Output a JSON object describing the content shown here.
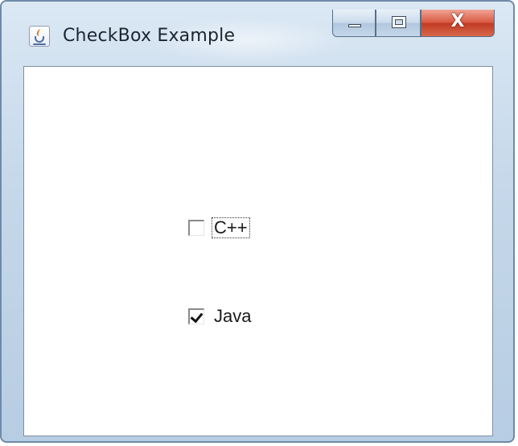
{
  "window": {
    "title": "CheckBox Example",
    "app_icon": "java-cup-icon",
    "controls": {
      "minimize_icon": "minimize-icon",
      "maximize_icon": "maximize-icon",
      "close_icon": "close-icon",
      "close_glyph": "X"
    }
  },
  "checkboxes": [
    {
      "label": "C++",
      "checked": false,
      "focused": true
    },
    {
      "label": "Java",
      "checked": true,
      "focused": false
    }
  ],
  "colors": {
    "close_button": "#c13b22",
    "window_frame": "#b7cde3",
    "content_background": "#ffffff"
  }
}
